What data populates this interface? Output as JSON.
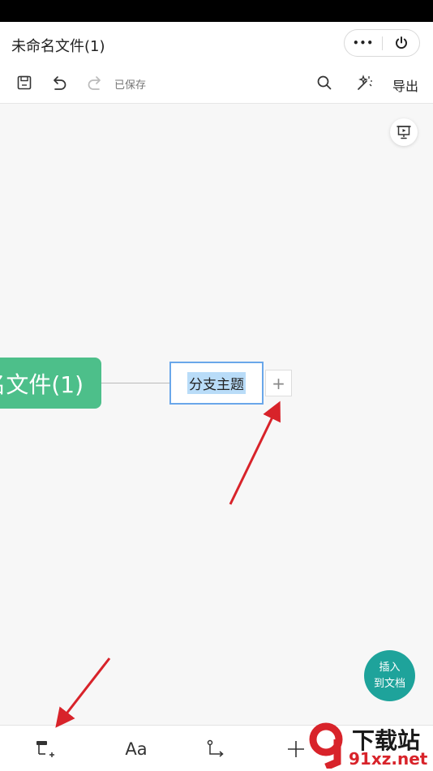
{
  "header": {
    "title": "未命名文件(1)",
    "more_label": "•••",
    "saved_status": "已保存",
    "export_label": "导出"
  },
  "canvas": {
    "root_topic": "名文件(1)",
    "branch_topic": "分支主题",
    "add_symbol": "+"
  },
  "insert_button": {
    "line1": "插入",
    "line2": "到文档"
  },
  "bottom_bar": {
    "font_label": "Aa"
  },
  "watermark": {
    "line1": "下载站",
    "line2": "91xz.net"
  },
  "colors": {
    "root_node": "#4dbf8a",
    "branch_border": "#6aa7ea",
    "branch_highlight": "#b9dcf8",
    "insert_button": "#1ea39b",
    "annotation_arrow": "#d8232a"
  },
  "icons": {
    "save": "save-icon",
    "undo": "undo-icon",
    "redo": "redo-icon",
    "search": "search-icon",
    "style": "magic-wand-icon",
    "power": "power-icon",
    "present": "presentation-icon",
    "add_subtopic": "add-subtopic-icon",
    "connect": "connector-icon"
  }
}
